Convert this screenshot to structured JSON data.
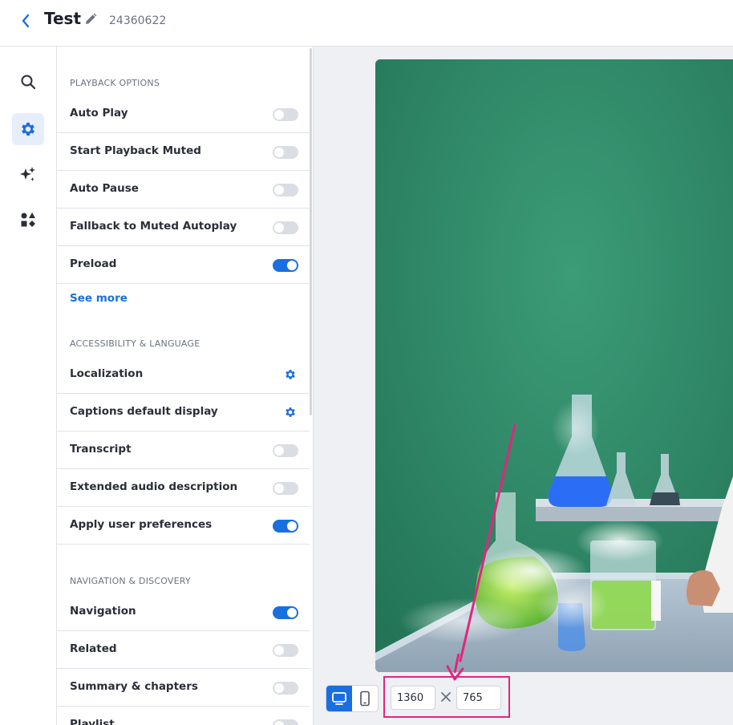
{
  "header": {
    "title": "Test",
    "video_id": "24360622"
  },
  "rail": {
    "items": [
      "search-icon",
      "gear-icon",
      "sparkles-icon",
      "shapes-icon"
    ],
    "active": "gear-icon"
  },
  "sections": [
    {
      "title": "PLAYBACK OPTIONS",
      "rows": [
        {
          "label": "Auto Play",
          "control": "toggle",
          "on": false
        },
        {
          "label": "Start Playback Muted",
          "control": "toggle",
          "on": false
        },
        {
          "label": "Auto Pause",
          "control": "toggle",
          "on": false
        },
        {
          "label": "Fallback to Muted Autoplay",
          "control": "toggle",
          "on": false
        },
        {
          "label": "Preload",
          "control": "toggle",
          "on": true
        }
      ],
      "see_more": "See more"
    },
    {
      "title": "ACCESSIBILITY & LANGUAGE",
      "rows": [
        {
          "label": "Localization",
          "control": "gear"
        },
        {
          "label": "Captions default display",
          "control": "gear"
        },
        {
          "label": "Transcript",
          "control": "toggle",
          "on": false
        },
        {
          "label": "Extended audio description",
          "control": "toggle",
          "on": false
        },
        {
          "label": "Apply user preferences",
          "control": "toggle",
          "on": true
        }
      ]
    },
    {
      "title": "NAVIGATION & DISCOVERY",
      "rows": [
        {
          "label": "Navigation",
          "control": "toggle",
          "on": true
        },
        {
          "label": "Related",
          "control": "toggle",
          "on": false
        },
        {
          "label": "Summary & chapters",
          "control": "toggle",
          "on": false
        },
        {
          "label": "Playlist",
          "control": "toggle",
          "on": false
        }
      ]
    }
  ],
  "preview": {
    "device": "desktop",
    "width_value": "1360",
    "height_value": "765"
  },
  "colors": {
    "accent": "#1a6fe0",
    "highlight": "#e0267f",
    "video_bg": "#2e8a66"
  }
}
